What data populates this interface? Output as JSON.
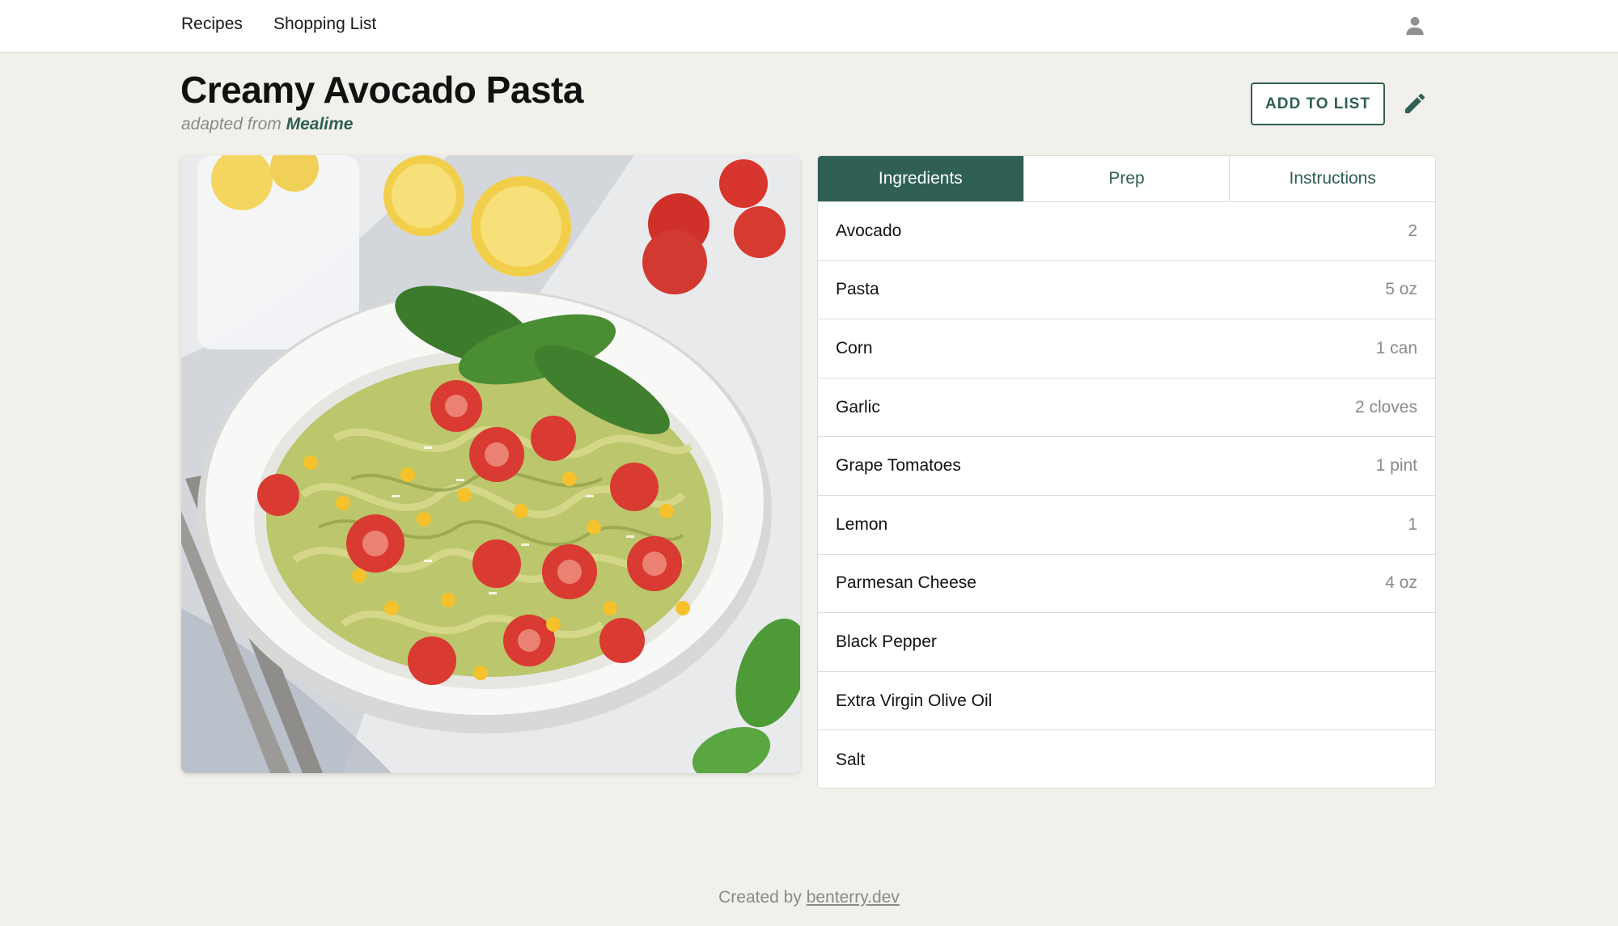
{
  "nav": {
    "links": [
      "Recipes",
      "Shopping List"
    ],
    "user_icon": "user-icon"
  },
  "recipe": {
    "title": "Creamy Avocado Pasta",
    "adapted_prefix": "adapted from",
    "source": "Mealime",
    "image_alt": "bowl of creamy avocado pasta with tomatoes, corn and basil"
  },
  "actions": {
    "add_to_list": "ADD TO LIST",
    "edit_icon": "pencil-icon"
  },
  "tabs": [
    {
      "label": "Ingredients",
      "active": true
    },
    {
      "label": "Prep",
      "active": false
    },
    {
      "label": "Instructions",
      "active": false
    }
  ],
  "ingredients": [
    {
      "name": "Avocado",
      "qty": "2"
    },
    {
      "name": "Pasta",
      "qty": "5 oz"
    },
    {
      "name": "Corn",
      "qty": "1 can"
    },
    {
      "name": "Garlic",
      "qty": "2 cloves"
    },
    {
      "name": "Grape Tomatoes",
      "qty": "1 pint"
    },
    {
      "name": "Lemon",
      "qty": "1"
    },
    {
      "name": "Parmesan Cheese",
      "qty": "4 oz"
    },
    {
      "name": "Black Pepper",
      "qty": ""
    },
    {
      "name": "Extra Virgin Olive Oil",
      "qty": ""
    },
    {
      "name": "Salt",
      "qty": ""
    }
  ],
  "footer": {
    "prefix": "Created by",
    "link": "benterry.dev"
  },
  "colors": {
    "accent": "#2f5f55",
    "background": "#f1f0ea",
    "muted_text": "#8a8a86"
  }
}
